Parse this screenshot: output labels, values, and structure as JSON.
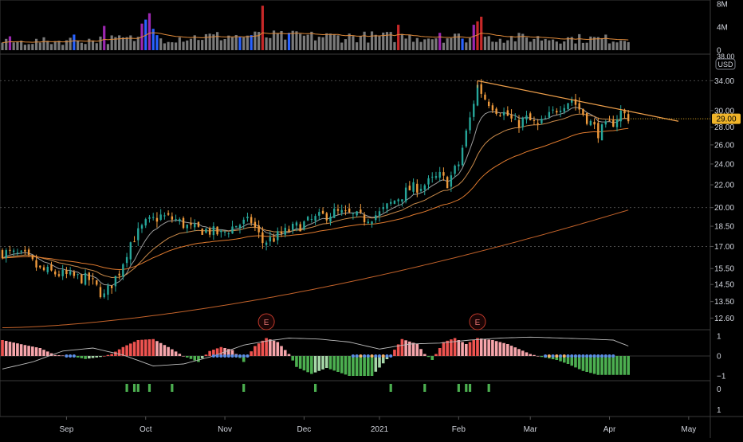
{
  "chart_data": {
    "type": "candlestick",
    "currency_label": "USD",
    "last_price": {
      "label": "29.00",
      "value": 29.0,
      "color": "#f0b429"
    },
    "price_axis": {
      "scale": "log",
      "range": [
        12.0,
        38.0
      ],
      "ticks": [
        "12.60",
        "13.50",
        "14.50",
        "15.50",
        "17.00",
        "18.50",
        "20.00",
        "22.00",
        "24.00",
        "26.00",
        "28.00",
        "30.00",
        "34.00"
      ],
      "dotted_lines": [
        17.0,
        20.0,
        34.0
      ]
    },
    "x_axis": {
      "months": [
        "Sep",
        "Oct",
        "Nov",
        "Dec",
        "2021",
        "Feb",
        "Mar",
        "Apr",
        "May"
      ],
      "month_index": [
        17,
        38,
        59,
        80,
        100,
        121,
        140,
        161,
        182
      ]
    },
    "colors": {
      "up": "#26a69a",
      "down": "#ef9a3c",
      "wick": "#bfbfbf",
      "ema_fast": "#9c9c9c",
      "ema_mid": "#c98a4a",
      "ema_slow": "#e07a2e",
      "sma_long": "#c2622a",
      "trendline": "#f0a04b",
      "vol_grey": "#7a7a7a",
      "vol_blue": "#2962ff",
      "vol_purple": "#9c27b0",
      "vol_red": "#c62828",
      "hist_up": "#ef5350",
      "hist_up_light": "#f6a5ab",
      "hist_dn": "#4caf50",
      "hist_dn_light": "#a5d6a7",
      "axis_bg": "#000000",
      "text": "#d1d4dc"
    },
    "ohlc_anchors": [
      [
        0,
        16.6
      ],
      [
        6,
        16.3
      ],
      [
        10,
        15.4
      ],
      [
        14,
        15.2
      ],
      [
        18,
        15.0
      ],
      [
        23,
        14.8
      ],
      [
        27,
        13.8
      ],
      [
        31,
        15.3
      ],
      [
        34,
        17.3
      ],
      [
        38,
        18.7
      ],
      [
        42,
        19.3
      ],
      [
        46,
        19.0
      ],
      [
        50,
        18.3
      ],
      [
        54,
        18.2
      ],
      [
        58,
        17.9
      ],
      [
        62,
        18.6
      ],
      [
        66,
        18.9
      ],
      [
        69,
        17.3
      ],
      [
        72,
        17.6
      ],
      [
        76,
        18.2
      ],
      [
        80,
        18.7
      ],
      [
        84,
        19.2
      ],
      [
        88,
        19.6
      ],
      [
        92,
        19.4
      ],
      [
        96,
        19.1
      ],
      [
        100,
        19.5
      ],
      [
        104,
        20.6
      ],
      [
        108,
        21.6
      ],
      [
        112,
        22.0
      ],
      [
        116,
        22.8
      ],
      [
        118,
        22.2
      ],
      [
        121,
        24.0
      ],
      [
        124,
        29.0
      ],
      [
        126,
        33.3
      ],
      [
        128,
        31.6
      ],
      [
        131,
        30.2
      ],
      [
        134,
        29.4
      ],
      [
        136,
        28.3
      ],
      [
        139,
        29.0
      ],
      [
        142,
        28.1
      ],
      [
        145,
        29.3
      ],
      [
        148,
        30.7
      ],
      [
        151,
        31.5
      ],
      [
        153,
        30.2
      ],
      [
        156,
        28.5
      ],
      [
        158,
        27.4
      ],
      [
        160,
        28.0
      ],
      [
        162,
        28.6
      ],
      [
        164,
        29.8
      ],
      [
        166,
        29.2
      ]
    ],
    "volume": {
      "axis_ticks": [
        "0",
        "4M",
        "8M"
      ],
      "axis_values": [
        0,
        4,
        8
      ],
      "unit": "M",
      "baseline_values": [
        1.5,
        2.7,
        2.5,
        2.1
      ],
      "spike_bars": [
        {
          "index": 2,
          "value": 2.4,
          "color": "#9c27b0"
        },
        {
          "index": 19,
          "value": 2.7,
          "color": "#2962ff"
        },
        {
          "index": 27,
          "value": 4.2,
          "color": "#9c27b0"
        },
        {
          "index": 37,
          "value": 4.6,
          "color": "#9c27b0"
        },
        {
          "index": 38,
          "value": 5.3,
          "color": "#2962ff"
        },
        {
          "index": 39,
          "value": 6.4,
          "color": "#9c27b0"
        },
        {
          "index": 40,
          "value": 3.7,
          "color": "#2962ff"
        },
        {
          "index": 41,
          "value": 2.6,
          "color": "#2962ff"
        },
        {
          "index": 63,
          "value": 2.3,
          "color": "#2962ff"
        },
        {
          "index": 66,
          "value": 2.6,
          "color": "#2962ff"
        },
        {
          "index": 69,
          "value": 7.7,
          "color": "#c62828"
        },
        {
          "index": 76,
          "value": 3.0,
          "color": "#2962ff"
        },
        {
          "index": 105,
          "value": 4.4,
          "color": "#c62828"
        },
        {
          "index": 116,
          "value": 3.0,
          "color": "#9c27b0"
        },
        {
          "index": 122,
          "value": 2.0,
          "color": "#2962ff"
        },
        {
          "index": 125,
          "value": 4.4,
          "color": "#9c27b0"
        },
        {
          "index": 126,
          "value": 5.0,
          "color": "#c62828"
        },
        {
          "index": 127,
          "value": 5.8,
          "color": "#c62828"
        }
      ]
    },
    "earnings_markers": [
      {
        "index": 70,
        "label": "E"
      },
      {
        "index": 126,
        "label": "E"
      }
    ],
    "oscillator": {
      "axis_ticks": [
        "1",
        "0",
        "−1"
      ],
      "axis_values": [
        1,
        0,
        -1
      ],
      "hist_anchors": [
        [
          0,
          0.8
        ],
        [
          6,
          0.55
        ],
        [
          10,
          0.4
        ],
        [
          14,
          0.05
        ],
        [
          18,
          0.0
        ],
        [
          22,
          -0.15
        ],
        [
          26,
          -0.05
        ],
        [
          29,
          0.1
        ],
        [
          32,
          0.45
        ],
        [
          36,
          0.8
        ],
        [
          40,
          0.85
        ],
        [
          44,
          0.45
        ],
        [
          48,
          0.0
        ],
        [
          52,
          -0.3
        ],
        [
          55,
          0.25
        ],
        [
          58,
          0.45
        ],
        [
          61,
          0.3
        ],
        [
          64,
          -0.3
        ],
        [
          67,
          0.5
        ],
        [
          70,
          0.9
        ],
        [
          73,
          0.7
        ],
        [
          76,
          0.1
        ],
        [
          78,
          -0.55
        ],
        [
          82,
          -0.9
        ],
        [
          86,
          -0.6
        ],
        [
          92,
          -1.0
        ],
        [
          98,
          -1.0
        ],
        [
          103,
          0.05
        ],
        [
          106,
          0.85
        ],
        [
          110,
          0.6
        ],
        [
          112,
          0.1
        ],
        [
          114,
          -0.2
        ],
        [
          117,
          0.7
        ],
        [
          120,
          0.9
        ],
        [
          123,
          0.6
        ],
        [
          126,
          0.9
        ],
        [
          130,
          0.8
        ],
        [
          134,
          0.6
        ],
        [
          137,
          0.35
        ],
        [
          140,
          0.1
        ],
        [
          143,
          -0.05
        ],
        [
          147,
          -0.2
        ],
        [
          150,
          -0.4
        ],
        [
          154,
          -0.75
        ],
        [
          158,
          -0.95
        ],
        [
          162,
          -0.95
        ],
        [
          166,
          -0.95
        ]
      ],
      "line_anchors": [
        [
          0,
          -0.65
        ],
        [
          8,
          -0.3
        ],
        [
          16,
          0.25
        ],
        [
          24,
          0.4
        ],
        [
          32,
          0.05
        ],
        [
          40,
          -0.5
        ],
        [
          48,
          -0.4
        ],
        [
          56,
          0.0
        ],
        [
          64,
          0.55
        ],
        [
          70,
          0.75
        ],
        [
          76,
          0.9
        ],
        [
          84,
          0.85
        ],
        [
          92,
          0.7
        ],
        [
          100,
          0.35
        ],
        [
          108,
          0.6
        ],
        [
          116,
          0.65
        ],
        [
          124,
          0.8
        ],
        [
          132,
          0.9
        ],
        [
          140,
          0.95
        ],
        [
          148,
          0.9
        ],
        [
          156,
          0.85
        ],
        [
          162,
          0.8
        ],
        [
          166,
          0.5
        ]
      ],
      "dot_indices": [
        17,
        18,
        19,
        56,
        57,
        58,
        59,
        60,
        61,
        62,
        63,
        64,
        65,
        93,
        94,
        95,
        96,
        97,
        98,
        99,
        100,
        101,
        102,
        103,
        144,
        145,
        146,
        147,
        148,
        149,
        150,
        151,
        152,
        153,
        154,
        155,
        156,
        157,
        158,
        159,
        160,
        161,
        162
      ]
    },
    "signal_pane": {
      "axis_ticks": [
        "0",
        "1"
      ],
      "axis_values": [
        0,
        1
      ],
      "bar_indices": [
        33,
        35,
        36,
        39,
        45,
        64,
        83,
        103,
        112,
        121,
        123,
        124,
        129
      ]
    }
  }
}
